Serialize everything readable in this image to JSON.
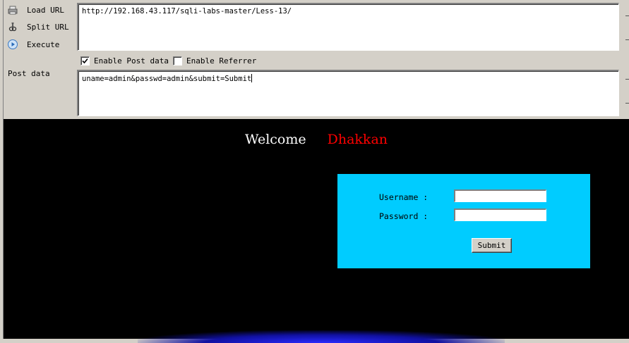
{
  "hackbar": {
    "actions": {
      "load": {
        "label": "Load URL",
        "icon": "load-url-icon"
      },
      "split": {
        "label": "Split URL",
        "icon": "split-url-icon"
      },
      "execute": {
        "label": "Execute",
        "icon": "execute-icon"
      }
    },
    "url_value": "http://192.168.43.117/sqli-labs-master/Less-13/",
    "enable_post": {
      "label": "Enable Post data",
      "checked": true
    },
    "enable_referrer": {
      "label": "Enable Referrer",
      "checked": false
    },
    "post_label": "Post data",
    "post_value": "uname=admin&passwd=admin&submit=Submit"
  },
  "page": {
    "welcome": "Welcome",
    "name": "Dhakkan",
    "form": {
      "username_label": "Username :",
      "password_label": "Password :",
      "username_value": "",
      "password_value": "",
      "submit_label": "Submit"
    },
    "colors": {
      "form_bg": "#00ccff",
      "name": "#ff0000",
      "page_bg": "#000000"
    }
  }
}
